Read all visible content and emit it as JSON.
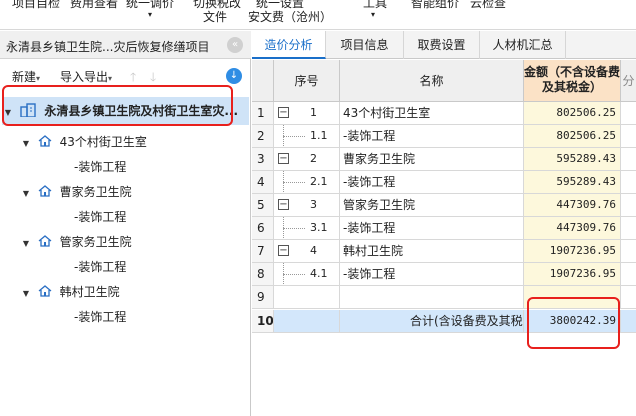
{
  "ribbon": {
    "items": [
      "项目自检",
      "费用查看",
      "统一调价",
      "切换税改",
      "文件",
      "统一设置",
      "安文费（沧州）",
      "工具",
      "智能组价",
      "云检查"
    ]
  },
  "left_panel": {
    "title": "永清县乡镇卫生院...灾后恢复修缮项目",
    "toolbar": {
      "new_label": "新建",
      "import_export_label": "导入导出"
    },
    "tree": {
      "root": "永清县乡镇卫生院及村街卫生室灾...",
      "groups": [
        {
          "name": "43个村街卫生室",
          "child": "-装饰工程"
        },
        {
          "name": "曹家务卫生院",
          "child": "-装饰工程"
        },
        {
          "name": "管家务卫生院",
          "child": "-装饰工程"
        },
        {
          "name": "韩村卫生院",
          "child": "-装饰工程"
        }
      ]
    }
  },
  "tabs": [
    {
      "label": "造价分析",
      "active": true
    },
    {
      "label": "项目信息",
      "active": false
    },
    {
      "label": "取费设置",
      "active": false
    },
    {
      "label": "人材机汇总",
      "active": false
    }
  ],
  "table": {
    "headers": {
      "seq": "序号",
      "name": "名称",
      "amount": "金额（不含设备费及其税金）",
      "extra": "分"
    },
    "rows": [
      {
        "rn": "1",
        "seq": "1",
        "name": "43个村街卫生室",
        "amount": "802506.25",
        "level": 0
      },
      {
        "rn": "2",
        "seq": "1.1",
        "name": "-装饰工程",
        "amount": "802506.25",
        "level": 1
      },
      {
        "rn": "3",
        "seq": "2",
        "name": "曹家务卫生院",
        "amount": "595289.43",
        "level": 0
      },
      {
        "rn": "4",
        "seq": "2.1",
        "name": "-装饰工程",
        "amount": "595289.43",
        "level": 1
      },
      {
        "rn": "5",
        "seq": "3",
        "name": "管家务卫生院",
        "amount": "447309.76",
        "level": 0
      },
      {
        "rn": "6",
        "seq": "3.1",
        "name": "-装饰工程",
        "amount": "447309.76",
        "level": 1
      },
      {
        "rn": "7",
        "seq": "4",
        "name": "韩村卫生院",
        "amount": "1907236.95",
        "level": 0
      },
      {
        "rn": "8",
        "seq": "4.1",
        "name": "-装饰工程",
        "amount": "1907236.95",
        "level": 1
      },
      {
        "rn": "9",
        "seq": "",
        "name": "",
        "amount": "",
        "level": 2
      }
    ],
    "total": {
      "rn": "10",
      "name": "合计(含设备费及其税金)",
      "amount": "3800242.39"
    }
  },
  "colors": {
    "accent": "#1a6fc9",
    "highlight_box": "#e8201d",
    "selected_row": "#cfe3f7",
    "amount_header": "#fbe2c6"
  },
  "icons": [
    "building-icon",
    "house-icon",
    "expand-toggle-icon",
    "collapse-icon",
    "download-icon"
  ]
}
